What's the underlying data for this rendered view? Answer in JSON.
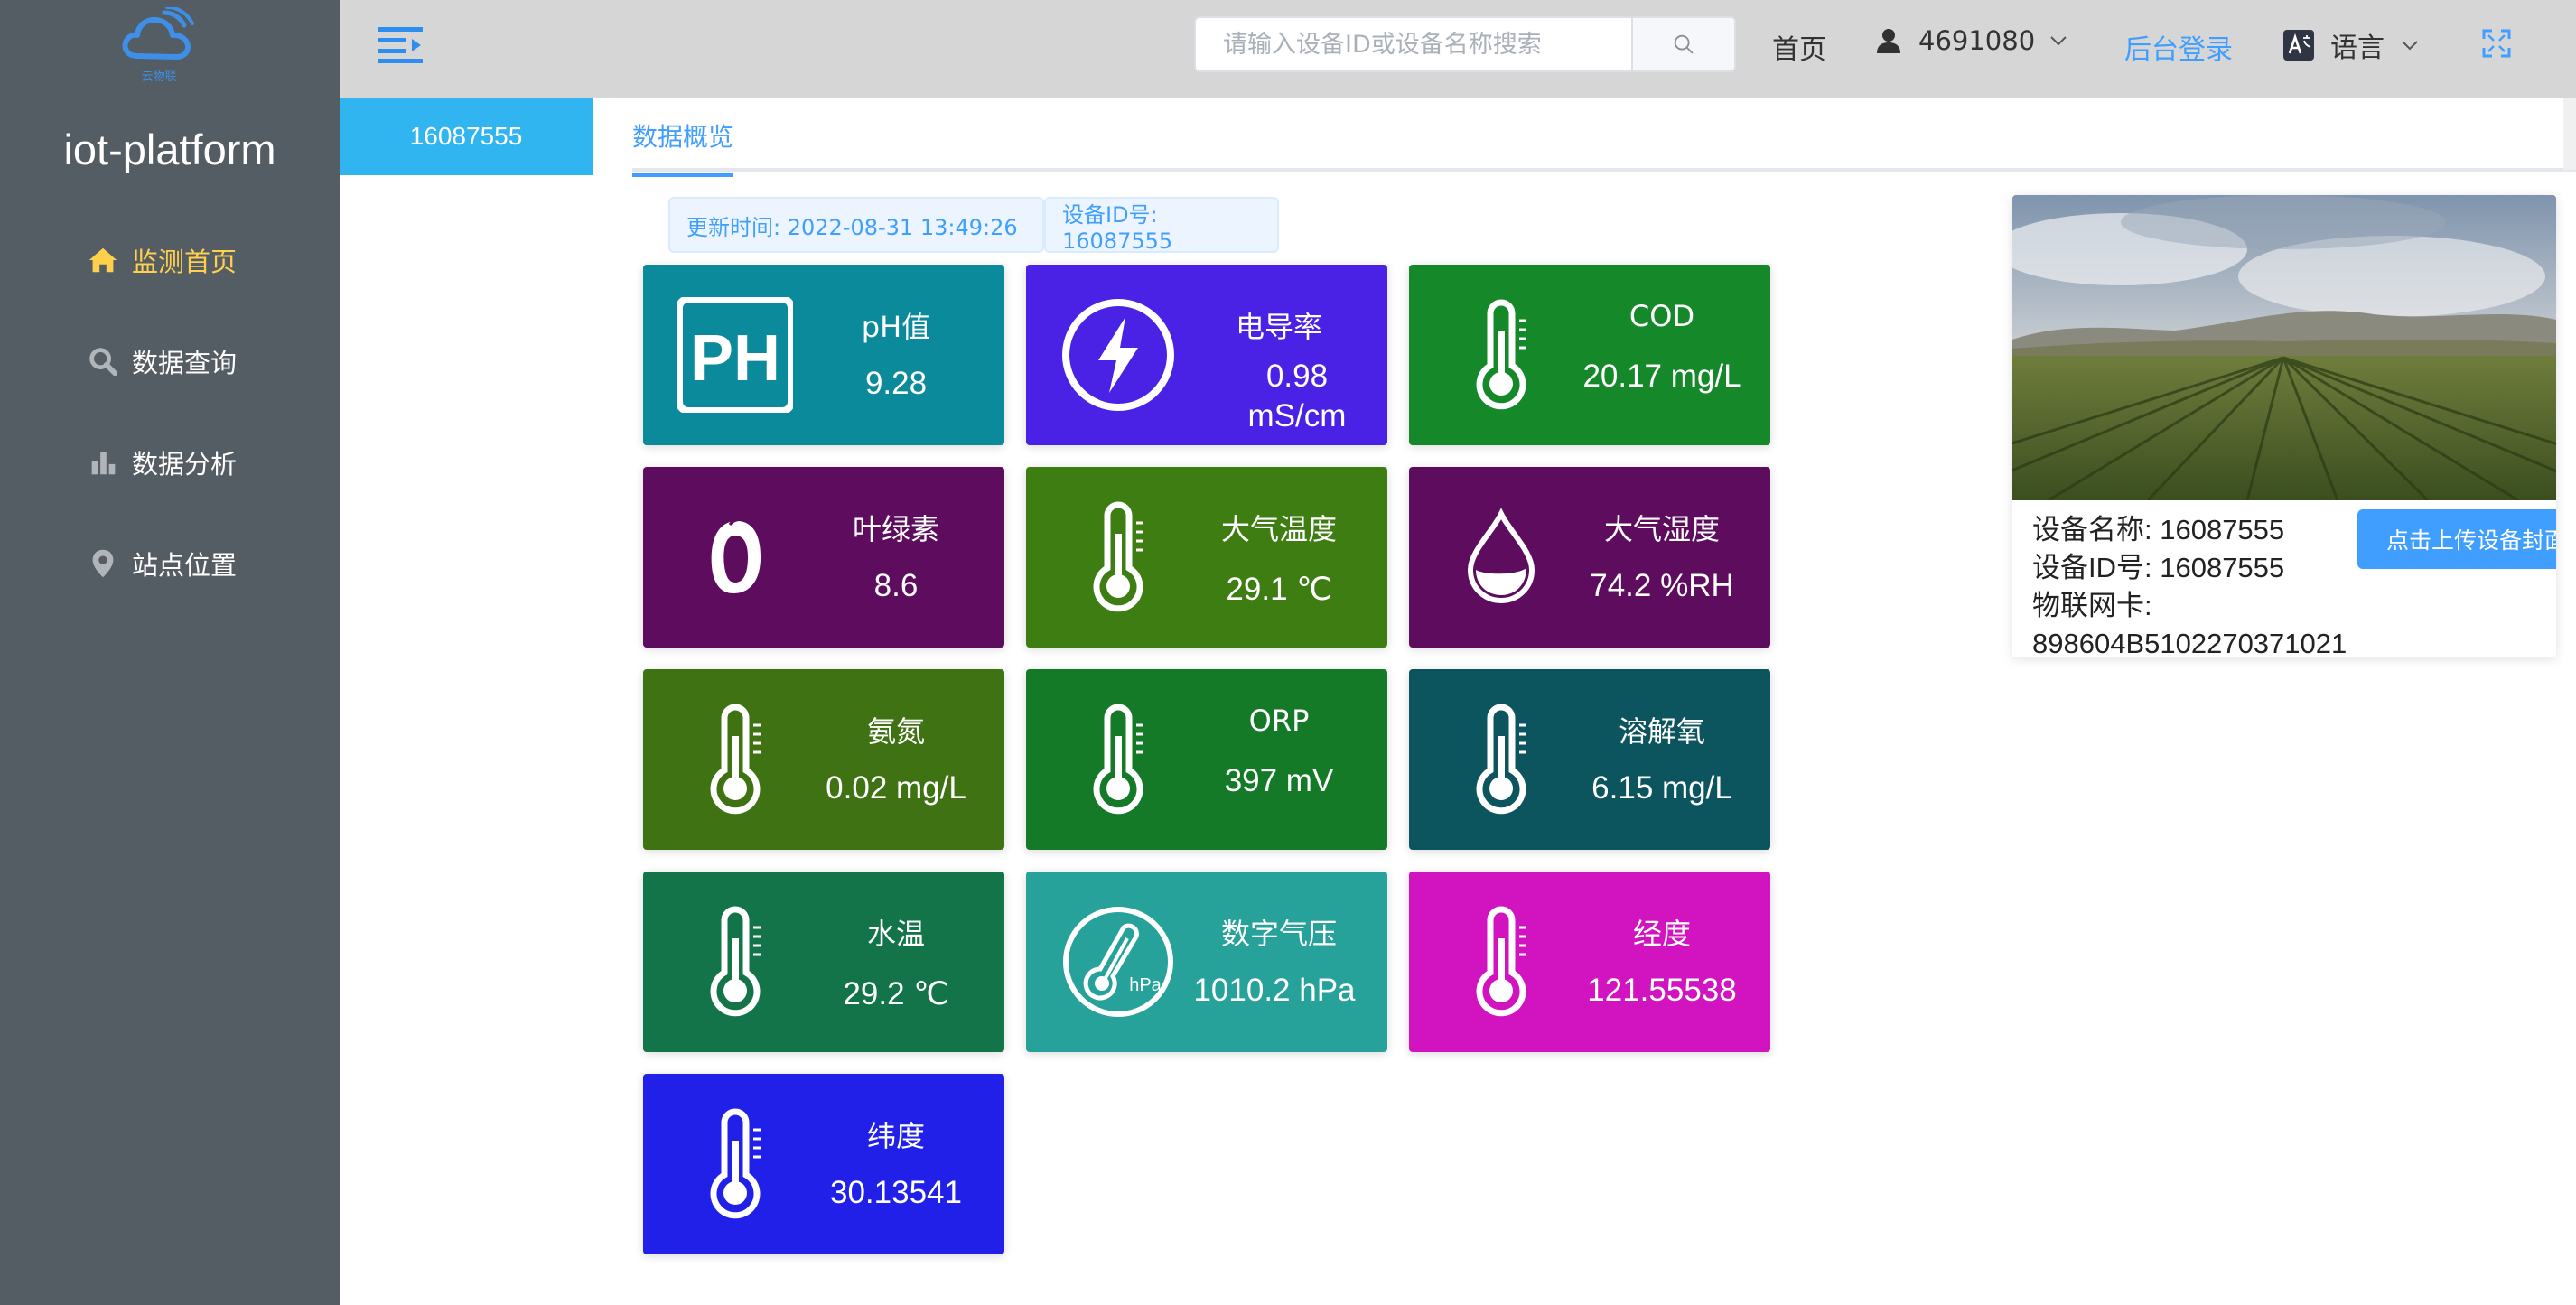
{
  "sidebar": {
    "logo_text": "云物联",
    "brand": "iot-platform",
    "menu": [
      {
        "label": "监测首页",
        "icon": "home-icon",
        "active": true
      },
      {
        "label": "数据查询",
        "icon": "search-icon",
        "active": false
      },
      {
        "label": "数据分析",
        "icon": "bar-chart-icon",
        "active": false
      },
      {
        "label": "站点位置",
        "icon": "location-pin-icon",
        "active": false
      }
    ]
  },
  "header": {
    "search_placeholder": "请输入设备ID或设备名称搜索",
    "home": "首页",
    "username": "4691080",
    "admin_login": "后台登录",
    "language": "语言"
  },
  "tabs": {
    "device_tab": "16087555",
    "overview": "数据概览"
  },
  "info": {
    "update_time": "更新时间: 2022-08-31 13:49:26",
    "device_id": "设备ID号: 16087555"
  },
  "cards": [
    {
      "title": "pH值",
      "value": "9.28",
      "icon": "ph-icon",
      "color": "#0a8a9a"
    },
    {
      "title": "电导率",
      "value": "0.98 mS/cm",
      "icon": "lightning-icon",
      "color": "#4a22e6"
    },
    {
      "title": "COD",
      "value": "20.17 mg/L",
      "icon": "thermometer-icon",
      "color": "#15882a"
    },
    {
      "title": "叶绿素",
      "value": "8.6",
      "icon": "chlorophyll-icon",
      "color": "#5e0d5e"
    },
    {
      "title": "大气温度",
      "value": "29.1 ℃",
      "icon": "thermometer-icon",
      "color": "#3e7d12"
    },
    {
      "title": "大气湿度",
      "value": "74.2 %RH",
      "icon": "droplet-icon",
      "color": "#5e0d5e"
    },
    {
      "title": "氨氮",
      "value": "0.02 mg/L",
      "icon": "thermometer-icon",
      "color": "#3e7212"
    },
    {
      "title": "ORP",
      "value": "397 mV",
      "icon": "thermometer-icon",
      "color": "#157a28"
    },
    {
      "title": "溶解氧",
      "value": "6.15 mg/L",
      "icon": "thermometer-icon",
      "color": "#0c545e"
    },
    {
      "title": "水温",
      "value": "29.2 ℃",
      "icon": "thermometer-icon",
      "color": "#137349"
    },
    {
      "title": "数字气压",
      "value": "1010.2 hPa",
      "icon": "pressure-gauge-icon",
      "color": "#27a29b"
    },
    {
      "title": "经度",
      "value": "121.55538",
      "icon": "thermometer-icon",
      "color": "#d114c0"
    },
    {
      "title": "纬度",
      "value": "30.13541",
      "icon": "thermometer-icon",
      "color": "#2020e8"
    }
  ],
  "device": {
    "name": "设备名称: 16087555",
    "id": "设备ID号: 16087555",
    "sim_label": "物联网卡:",
    "sim": "898604B5102270371021",
    "upload_button": "点击上传设备封面"
  }
}
